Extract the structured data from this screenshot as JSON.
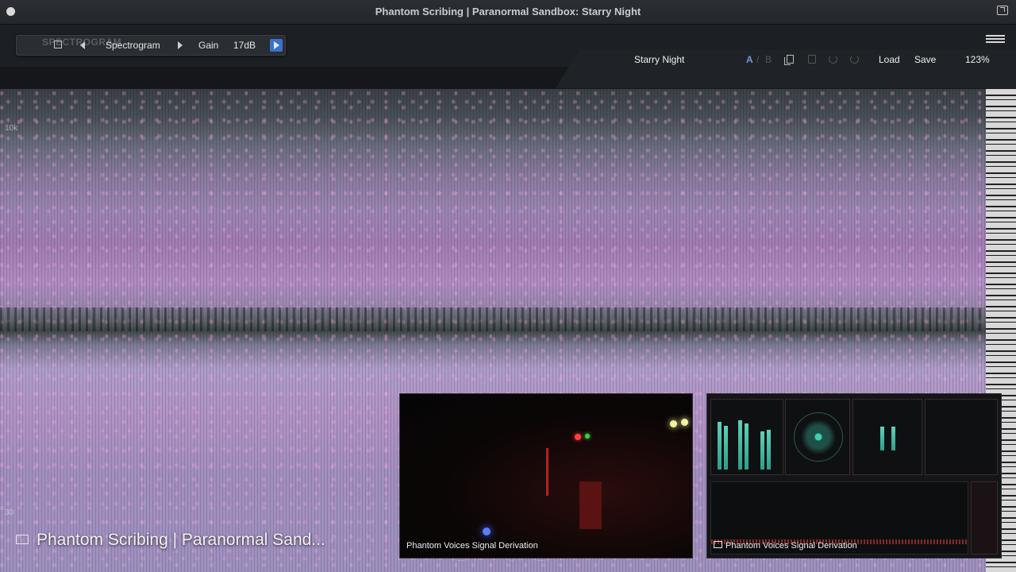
{
  "window": {
    "title": "Phantom Scribing | Paranormal Sandbox: Starry Night"
  },
  "plugin": {
    "logo_text": "SPECTROGRAM",
    "mode_label": "Spectrogram",
    "gain_label": "Gain",
    "gain_value": "17dB",
    "preset_name": "Starry Night",
    "ab": {
      "a": "A",
      "sep": "/",
      "b": "B"
    },
    "load_label": "Load",
    "save_label": "Save",
    "zoom": "123%"
  },
  "spectrogram": {
    "freq_labels": [
      "10k",
      "30"
    ]
  },
  "overlay": {
    "main_caption": "Phantom Scribing | Paranormal Sand...",
    "file_ghost": "TB_Spectrogram_V1"
  },
  "tiles": {
    "camera_label": "Phantom Voices Signal Derivation",
    "meters_label": "Phantom Voices Signal Derivation"
  },
  "icons": [
    "window-dot-icon",
    "popout-icon",
    "crop-icon",
    "prev-icon",
    "next-icon",
    "play-icon",
    "menu-icon",
    "copy-icon",
    "paste-icon",
    "undo-icon",
    "redo-icon",
    "screen-icon"
  ],
  "colors": {
    "accent": "#3a72c8",
    "ab_active": "#6f9be0",
    "spectro_pink": "#b08cc4"
  }
}
